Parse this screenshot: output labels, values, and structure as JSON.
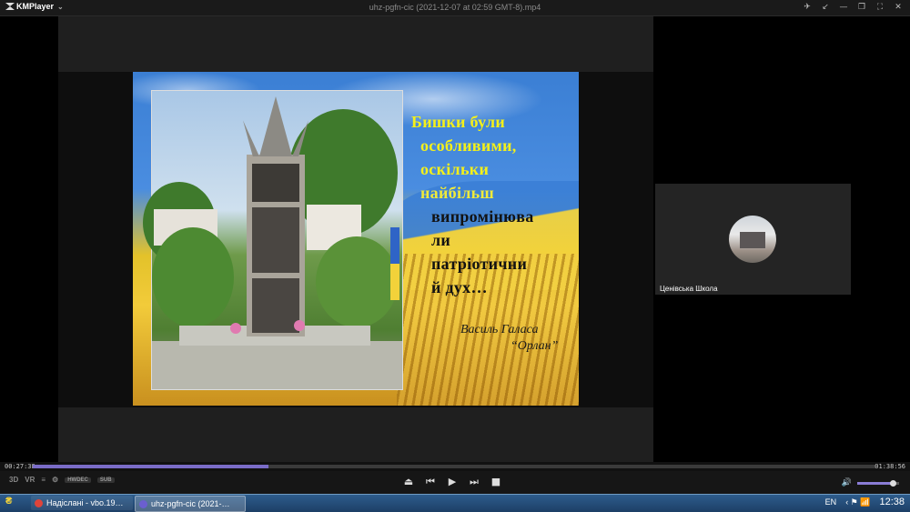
{
  "app": {
    "brand": "KMPlayer",
    "window_title": "uhz-pgfn-cic (2021-12-07 at 02:59 GMT-8).mp4",
    "window_buttons": [
      "pin-icon",
      "compact-icon",
      "minimize-icon",
      "restore-icon",
      "fullscreen-icon",
      "close-icon"
    ]
  },
  "slide": {
    "poem_lines": [
      "Бишки були",
      "особливими,",
      "оскільки",
      "найбільш",
      "випромінюва",
      "ли",
      "патріотични",
      "й дух…"
    ],
    "author": "Василь Галаса",
    "work": "“Орлан”"
  },
  "participant": {
    "name": "Ценівська Школа"
  },
  "player": {
    "time_current": "00:27:38",
    "time_total": "01:38:56",
    "progress": 0.28,
    "volume": 0.85,
    "left_labels": [
      "3D",
      "VR",
      "≡",
      "⚙"
    ],
    "pills": [
      "HWDEC",
      "SUB"
    ],
    "transport_icons": [
      "eject-icon",
      "prev-icon",
      "play-icon",
      "next-icon",
      "stop-icon"
    ]
  },
  "taskbar": {
    "tasks": [
      {
        "label": "Надіслані - vbo.19…",
        "color": "#e0443a"
      },
      {
        "label": "uhz-pgfn-cic (2021-…",
        "color": "#6b5fd0"
      }
    ],
    "language": "EN",
    "clock": "12:38"
  }
}
